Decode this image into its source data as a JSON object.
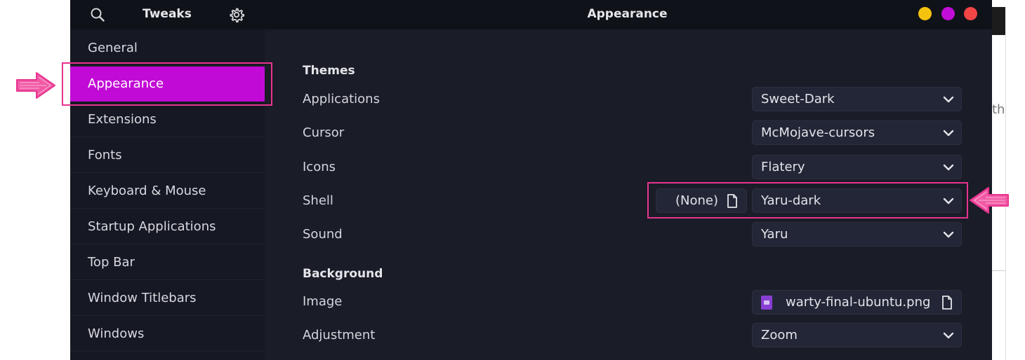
{
  "header": {
    "app_name": "Tweaks",
    "page_title": "Appearance",
    "window_buttons": [
      {
        "name": "minimize",
        "color": "#f5c30e"
      },
      {
        "name": "maximize",
        "color": "#c10dd8"
      },
      {
        "name": "close",
        "color": "#f24545"
      }
    ]
  },
  "sidebar": {
    "items": [
      {
        "label": "General",
        "active": false
      },
      {
        "label": "Appearance",
        "active": true
      },
      {
        "label": "Extensions",
        "active": false
      },
      {
        "label": "Fonts",
        "active": false
      },
      {
        "label": "Keyboard & Mouse",
        "active": false
      },
      {
        "label": "Startup Applications",
        "active": false
      },
      {
        "label": "Top Bar",
        "active": false
      },
      {
        "label": "Window Titlebars",
        "active": false
      },
      {
        "label": "Windows",
        "active": false
      }
    ]
  },
  "themes": {
    "title": "Themes",
    "applications": {
      "label": "Applications",
      "value": "Sweet-Dark"
    },
    "cursor": {
      "label": "Cursor",
      "value": "McMojave-cursors"
    },
    "icons": {
      "label": "Icons",
      "value": "Flatery"
    },
    "shell": {
      "label": "Shell",
      "file_value": "(None)",
      "value": "Yaru-dark"
    },
    "sound": {
      "label": "Sound",
      "value": "Yaru"
    }
  },
  "background": {
    "title": "Background",
    "image": {
      "label": "Image",
      "value": "warty-final-ubuntu.png"
    },
    "adjustment": {
      "label": "Adjustment",
      "value": "Zoom"
    }
  },
  "background_window": {
    "partial_text": "th"
  },
  "colors": {
    "accent": "#c20ad6",
    "annotation": "#e8348f",
    "window_bg": "#1a1c27",
    "sidebar_bg": "#161823",
    "headerbar_bg": "#10121a"
  },
  "icons": {
    "search": "search-icon",
    "settings": "gear-icon",
    "dropdown": "chevron-down-icon",
    "file": "document-icon",
    "image": "image-file-icon",
    "annotation": "arrow-icon"
  }
}
